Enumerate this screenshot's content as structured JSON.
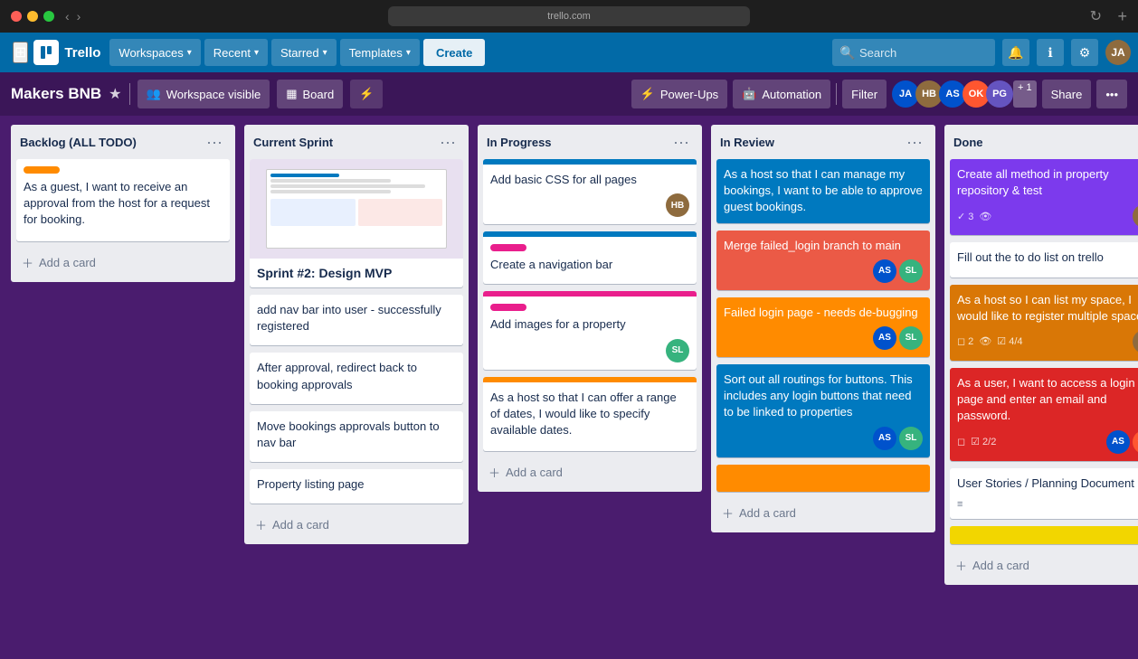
{
  "titlebar": {
    "url": ""
  },
  "navbar": {
    "workspaces_label": "Workspaces",
    "recent_label": "Recent",
    "starred_label": "Starred",
    "templates_label": "Templates",
    "create_label": "Create",
    "search_placeholder": "Search"
  },
  "board_header": {
    "title": "Makers BNB",
    "workspace_visible_label": "Workspace visible",
    "board_label": "Board",
    "power_ups_label": "Power-Ups",
    "automation_label": "Automation",
    "filter_label": "Filter",
    "share_label": "Share",
    "plus_count": "+ 1"
  },
  "lists": [
    {
      "id": "backlog",
      "title": "Backlog (ALL TODO)",
      "cards": [
        {
          "id": "b1",
          "label_color": "orange",
          "text": "As a guest, I want to receive an approval from the host for a request for booking.",
          "has_add_btn": true
        }
      ],
      "add_card_label": "Add a card"
    },
    {
      "id": "current-sprint",
      "title": "Current Sprint",
      "has_sprint_card": true,
      "sprint_card_title": "Sprint #2: Design MVP",
      "cards": [
        {
          "id": "cs1",
          "text": "add nav bar into user - successfully registered"
        },
        {
          "id": "cs2",
          "text": "After approval, redirect back to booking approvals"
        },
        {
          "id": "cs3",
          "text": "Move bookings approvals button to nav bar"
        },
        {
          "id": "cs4",
          "text": "Property listing page"
        }
      ],
      "add_card_label": "Add a card"
    },
    {
      "id": "in-progress",
      "title": "In Progress",
      "cards": [
        {
          "id": "ip1",
          "color_top": "blue",
          "text": "Add basic CSS for all pages",
          "avatars": [
            "hb"
          ]
        },
        {
          "id": "ip2",
          "color_top": "blue",
          "label_color": "pink",
          "text": "Create a navigation bar",
          "avatars": []
        },
        {
          "id": "ip3",
          "color_top": "pink",
          "label_color": "pink",
          "text": "Add images for a property",
          "avatars": [
            "sl"
          ]
        },
        {
          "id": "ip4",
          "color_top": "orange",
          "text": "As a host so that I can offer a range of dates, I would like to specify available dates.",
          "avatars": []
        }
      ],
      "add_card_label": "Add a card"
    },
    {
      "id": "in-review",
      "title": "In Review",
      "cards": [
        {
          "id": "ir1",
          "color": "blue",
          "text": "As a host so that I can manage my bookings, I want to be able to approve guest bookings."
        },
        {
          "id": "ir2",
          "color": "red",
          "text": "Merge failed_login branch to main",
          "avatars": [
            "as",
            "sl"
          ]
        },
        {
          "id": "ir3",
          "color": "orange",
          "text": "Failed login page - needs de-bugging",
          "avatars": [
            "as",
            "sl"
          ]
        },
        {
          "id": "ir4",
          "color": "blue",
          "text": "Sort out all routings for buttons. This includes any login buttons that need to be linked to properties",
          "avatars": [
            "as",
            "sl"
          ]
        }
      ],
      "add_card_label": "Add a card"
    },
    {
      "id": "done",
      "title": "Done",
      "cards": [
        {
          "id": "d1",
          "color": "purple",
          "text": "Create all method in property repository & test",
          "badge_count": "3",
          "avatars": [
            "hb"
          ]
        },
        {
          "id": "d2",
          "color": "none",
          "text": "Fill out the to do list on trello"
        },
        {
          "id": "d3",
          "color": "orange",
          "text": "As a host so I can list my space, I would like to register multiple spaces.",
          "badge_checks": "4/4",
          "badge_num": "2",
          "avatars": [
            "hb"
          ]
        },
        {
          "id": "d4",
          "color": "red",
          "text": "As a user, I want to access a login page and enter an email and password.",
          "badge_checks": "2/2",
          "avatars": [
            "as",
            "ok"
          ]
        },
        {
          "id": "d5",
          "color": "none",
          "text": "User Stories / Planning Document"
        }
      ],
      "add_card_label": "Add a card"
    }
  ]
}
